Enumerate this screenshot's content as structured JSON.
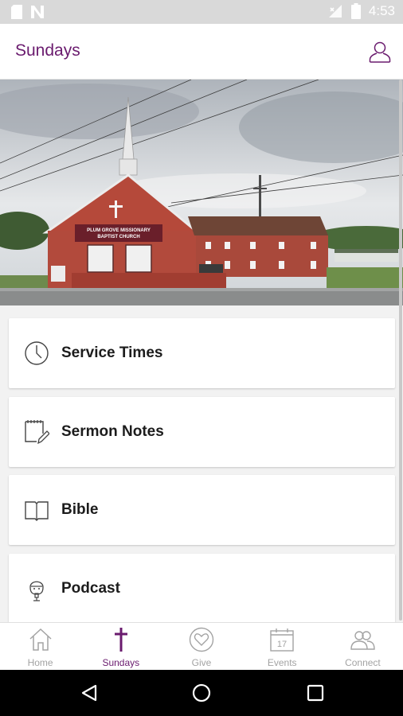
{
  "status_bar": {
    "time": "4:53",
    "left_icons": [
      "sd-card-icon",
      "notification-n-icon"
    ],
    "right_icons": [
      "signal-icon",
      "battery-icon"
    ]
  },
  "app_bar": {
    "title": "Sundays",
    "profile_icon": "user-icon"
  },
  "hero": {
    "church_sign_line1": "PLUM GROVE MISSIONARY",
    "church_sign_line2": "BAPTIST CHURCH"
  },
  "menu": {
    "items": [
      {
        "label": "Service Times",
        "icon": "clock-icon"
      },
      {
        "label": "Sermon Notes",
        "icon": "notepad-pencil-icon"
      },
      {
        "label": "Bible",
        "icon": "open-book-icon"
      },
      {
        "label": "Podcast",
        "icon": "microphone-person-icon"
      }
    ]
  },
  "bottom_nav": {
    "items": [
      {
        "label": "Home",
        "icon": "home-icon",
        "active": false
      },
      {
        "label": "Sundays",
        "icon": "cross-icon",
        "active": true
      },
      {
        "label": "Give",
        "icon": "heart-circle-icon",
        "active": false
      },
      {
        "label": "Events",
        "icon": "calendar-icon",
        "active": false,
        "calendar_day": "17"
      },
      {
        "label": "Connect",
        "icon": "people-icon",
        "active": false
      }
    ]
  },
  "system_nav": {
    "buttons": [
      "back-triangle-icon",
      "home-circle-icon",
      "recents-square-icon"
    ]
  },
  "colors": {
    "accent": "#6a1b6e",
    "inactive": "#a3a3a3",
    "status_bar_bg": "#d9d9d9"
  }
}
